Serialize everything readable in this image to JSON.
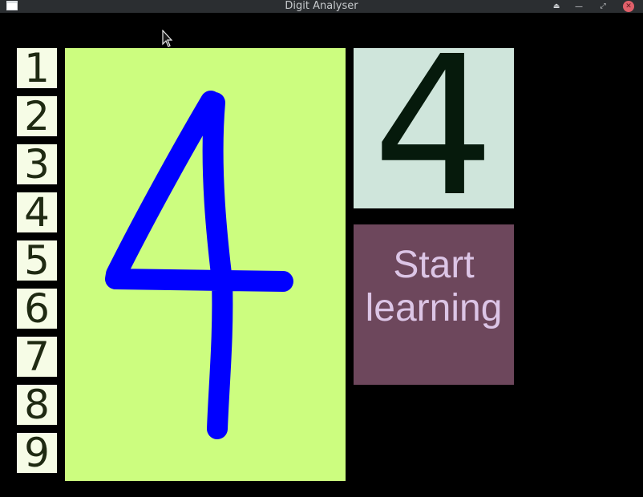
{
  "window": {
    "title": "Digit Analyser",
    "controls": [
      "keep-above",
      "minimize",
      "maximize",
      "close"
    ]
  },
  "digit_buttons": [
    "1",
    "2",
    "3",
    "4",
    "5",
    "6",
    "7",
    "8",
    "9"
  ],
  "canvas": {
    "background": "#ccfd7f",
    "stroke_color": "#0000ff",
    "drawn_digit_shape": "4"
  },
  "prediction": {
    "value": "4",
    "background": "#cfe5db"
  },
  "learn_button": {
    "line1": "Start",
    "line2": "learning",
    "background": "#6d475c",
    "text_color": "#dcc5e6"
  }
}
